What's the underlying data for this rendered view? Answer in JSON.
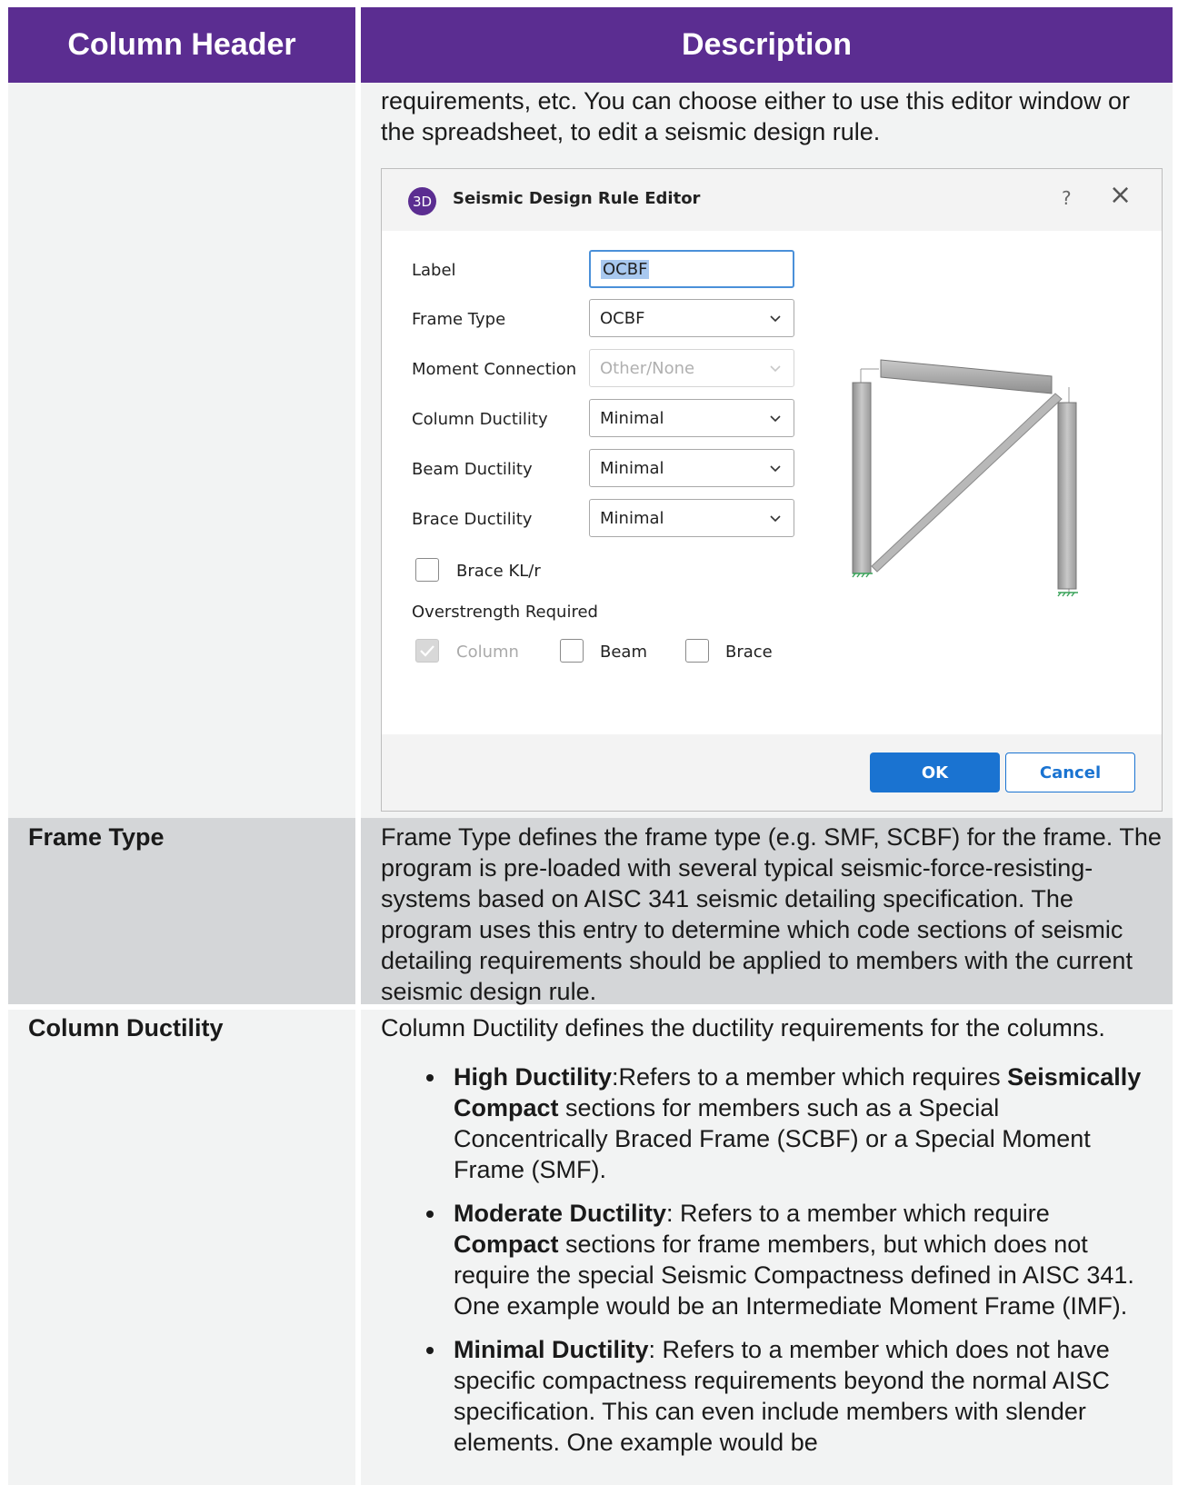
{
  "header": {
    "col1": "Column Header",
    "col2": "Description"
  },
  "row0": {
    "text": "requirements, etc. You can choose either to use this editor window or the spreadsheet, to edit a seismic design rule."
  },
  "dialog": {
    "logo": "3D",
    "title": "Seismic Design Rule Editor",
    "help": "?",
    "close": "×",
    "fields": {
      "label_label": "Label",
      "label_value": "OCBF",
      "frame_type_label": "Frame Type",
      "frame_type_value": "OCBF",
      "moment_conn_label": "Moment Connection",
      "moment_conn_value": "Other/None",
      "column_ductility_label": "Column Ductility",
      "column_ductility_value": "Minimal",
      "beam_ductility_label": "Beam Ductility",
      "beam_ductility_value": "Minimal",
      "brace_ductility_label": "Brace Ductility",
      "brace_ductility_value": "Minimal"
    },
    "brace_klr": "Brace KL/r",
    "overstrength_label": "Overstrength Required",
    "overstrength": {
      "column": "Column",
      "beam": "Beam",
      "brace": "Brace"
    },
    "ok": "OK",
    "cancel": "Cancel"
  },
  "row_frame_type": {
    "header": "Frame Type",
    "text": "Frame Type defines the frame type (e.g. SMF, SCBF) for the frame. The program is pre-loaded with several typical seismic-force-resisting-systems based on AISC 341 seismic detailing specification. The program uses this entry to determine which code sections of seismic detailing requirements should be applied to members with the current seismic design rule."
  },
  "row_column_ductility": {
    "header": "Column Ductility",
    "intro": "Column Ductility defines the ductility requirements for the columns.",
    "bullets": [
      {
        "b1": "High Ductility",
        "t1": ":Refers to a member which requires ",
        "b2": "Seismically Compact",
        "t2": " sections for members such as a Special Concentrically Braced Frame (SCBF) or a Special Moment Frame (SMF)."
      },
      {
        "b1": "Moderate Ductility",
        "t1": ": Refers to a member which require ",
        "b2": "Compact",
        "t2": " sections for frame members, but which does not require the special Seismic Compactness defined in AISC 341. One example would be an Intermediate Moment Frame (IMF)."
      },
      {
        "b1": "Minimal Ductility",
        "t1": ": Refers to a member which does not have specific compactness requirements beyond the normal AISC specification. This can even include members with slender elements. One example would be",
        "b2": "",
        "t2": ""
      }
    ]
  }
}
